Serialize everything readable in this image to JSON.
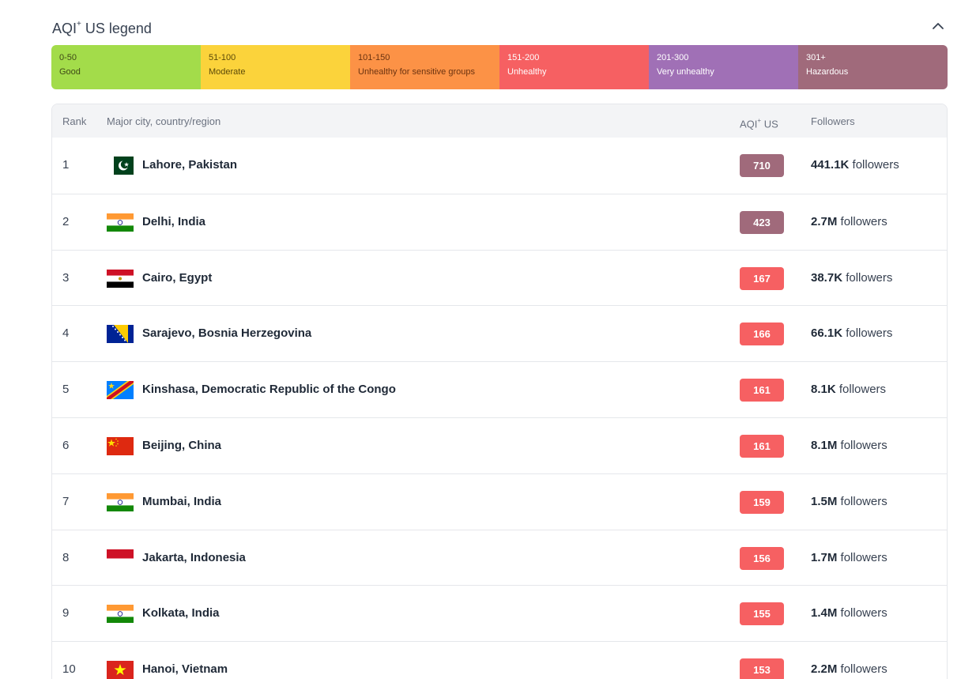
{
  "header": {
    "title": "AQI",
    "title_sup": "+",
    "title_rest": " US legend"
  },
  "legend": [
    {
      "range": "0-50",
      "label": "Good",
      "color": "#a3dc4a",
      "text": "#3f4a17"
    },
    {
      "range": "51-100",
      "label": "Moderate",
      "color": "#fbd33b",
      "text": "#5c4a09"
    },
    {
      "range": "101-150",
      "label": "Unhealthy for sensitive groups",
      "color": "#fc9246",
      "text": "#6b3310"
    },
    {
      "range": "151-200",
      "label": "Unhealthy",
      "color": "#f66062",
      "text": "#ffffff"
    },
    {
      "range": "201-300",
      "label": "Very unhealthy",
      "color": "#a070b6",
      "text": "#ffffff"
    },
    {
      "range": "301+",
      "label": "Hazardous",
      "color": "#a06a7b",
      "text": "#ffffff"
    }
  ],
  "table": {
    "headers": {
      "rank": "Rank",
      "city": "Major city, country/region",
      "aqi": "AQI",
      "aqi_sup": "+",
      "aqi_rest": " US",
      "followers": "Followers"
    },
    "rows": [
      {
        "rank": "1",
        "city": "Lahore, Pakistan",
        "flag": "pakistan",
        "aqi": "710",
        "color": "#a06a7b",
        "followers": "441.1K",
        "followers_suffix": " followers"
      },
      {
        "rank": "2",
        "city": "Delhi, India",
        "flag": "india",
        "aqi": "423",
        "color": "#a06a7b",
        "followers": "2.7M",
        "followers_suffix": " followers"
      },
      {
        "rank": "3",
        "city": "Cairo, Egypt",
        "flag": "egypt",
        "aqi": "167",
        "color": "#f66062",
        "followers": "38.7K",
        "followers_suffix": " followers"
      },
      {
        "rank": "4",
        "city": "Sarajevo, Bosnia Herzegovina",
        "flag": "bosnia",
        "aqi": "166",
        "color": "#f66062",
        "followers": "66.1K",
        "followers_suffix": " followers"
      },
      {
        "rank": "5",
        "city": "Kinshasa, Democratic Republic of the Congo",
        "flag": "drc",
        "aqi": "161",
        "color": "#f66062",
        "followers": "8.1K",
        "followers_suffix": " followers"
      },
      {
        "rank": "6",
        "city": "Beijing, China",
        "flag": "china",
        "aqi": "161",
        "color": "#f66062",
        "followers": "8.1M",
        "followers_suffix": " followers"
      },
      {
        "rank": "7",
        "city": "Mumbai, India",
        "flag": "india",
        "aqi": "159",
        "color": "#f66062",
        "followers": "1.5M",
        "followers_suffix": " followers"
      },
      {
        "rank": "8",
        "city": "Jakarta, Indonesia",
        "flag": "indonesia",
        "aqi": "156",
        "color": "#f66062",
        "followers": "1.7M",
        "followers_suffix": " followers"
      },
      {
        "rank": "9",
        "city": "Kolkata, India",
        "flag": "india",
        "aqi": "155",
        "color": "#f66062",
        "followers": "1.4M",
        "followers_suffix": " followers"
      },
      {
        "rank": "10",
        "city": "Hanoi, Vietnam",
        "flag": "vietnam",
        "aqi": "153",
        "color": "#f66062",
        "followers": "2.2M",
        "followers_suffix": " followers"
      }
    ]
  }
}
